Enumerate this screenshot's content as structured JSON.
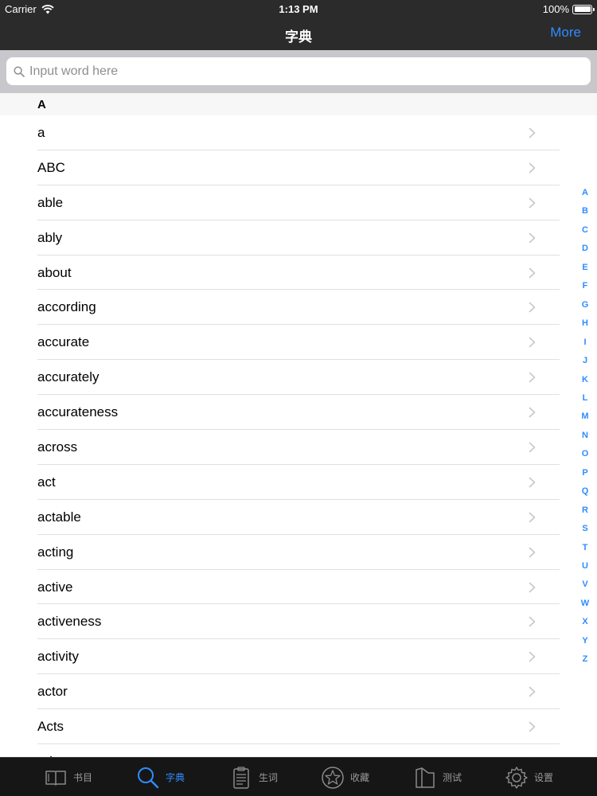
{
  "status_bar": {
    "carrier": "Carrier",
    "time": "1:13 PM",
    "battery": "100%"
  },
  "nav": {
    "title": "字典",
    "more": "More"
  },
  "search": {
    "placeholder": "Input word here",
    "value": ""
  },
  "section": {
    "title": "A"
  },
  "words": [
    "a",
    "ABC",
    "able",
    "ably",
    "about",
    "according",
    "accurate",
    "accurately",
    "accurateness",
    "across",
    "act",
    "actable",
    "acting",
    "active",
    "activeness",
    "activity",
    "actor",
    "Acts",
    "ad"
  ],
  "index": [
    "A",
    "B",
    "C",
    "D",
    "E",
    "F",
    "G",
    "H",
    "I",
    "J",
    "K",
    "L",
    "M",
    "N",
    "O",
    "P",
    "Q",
    "R",
    "S",
    "T",
    "U",
    "V",
    "W",
    "X",
    "Y",
    "Z"
  ],
  "tabs": [
    {
      "label": "书目",
      "icon": "book-icon",
      "active": false
    },
    {
      "label": "字典",
      "icon": "search-icon",
      "active": true
    },
    {
      "label": "生词",
      "icon": "clipboard-icon",
      "active": false
    },
    {
      "label": "收藏",
      "icon": "star-icon",
      "active": false
    },
    {
      "label": "测试",
      "icon": "test-book-icon",
      "active": false
    },
    {
      "label": "设置",
      "icon": "gear-icon",
      "active": false
    }
  ],
  "colors": {
    "accent": "#2f8cff",
    "bar": "#2b2b2b",
    "tab_bar": "#161616",
    "search_bg": "#c8c8cc"
  }
}
